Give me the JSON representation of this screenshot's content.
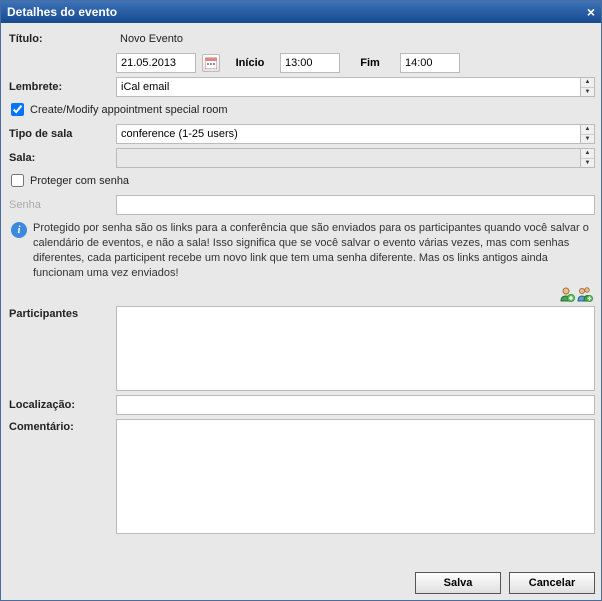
{
  "window": {
    "title": "Detalhes do evento"
  },
  "labels": {
    "titulo": "Título:",
    "lembrete": "Lembrete:",
    "tipo_sala": "Tipo de sala",
    "sala": "Sala:",
    "senha": "Senha",
    "participantes": "Participantes",
    "localizacao": "Localização:",
    "comentario": "Comentário:",
    "inicio": "Início",
    "fim": "Fim"
  },
  "values": {
    "titulo": "Novo Evento",
    "date": "21.05.2013",
    "inicio": "13:00",
    "fim": "14:00",
    "lembrete": "iCal email",
    "tipo_sala": "conference (1-25 users)",
    "sala": "",
    "senha": "",
    "participantes": "",
    "localizacao": "",
    "comentario": "",
    "create_modify_checked": true,
    "proteger_checked": false
  },
  "text": {
    "create_modify": "Create/Modify appointment special room",
    "proteger": "Proteger com senha",
    "info": "Protegido por senha são os links para a conferência que são enviados para os participantes quando você salvar o calendário de eventos, e não a sala! Isso significa que se você salvar o evento várias vezes, mas com senhas diferentes, cada participent recebe um novo link que tem uma senha diferente. Mas os links antigos ainda funcionam uma vez enviados!"
  },
  "buttons": {
    "save": "Salva",
    "cancel": "Cancelar"
  },
  "icons": {
    "calendar": "calendar-icon",
    "close": "×",
    "info": "i",
    "spin_up": "▲",
    "spin_down": "▼",
    "add_user": "add-user-icon",
    "add_users": "add-users-icon"
  }
}
